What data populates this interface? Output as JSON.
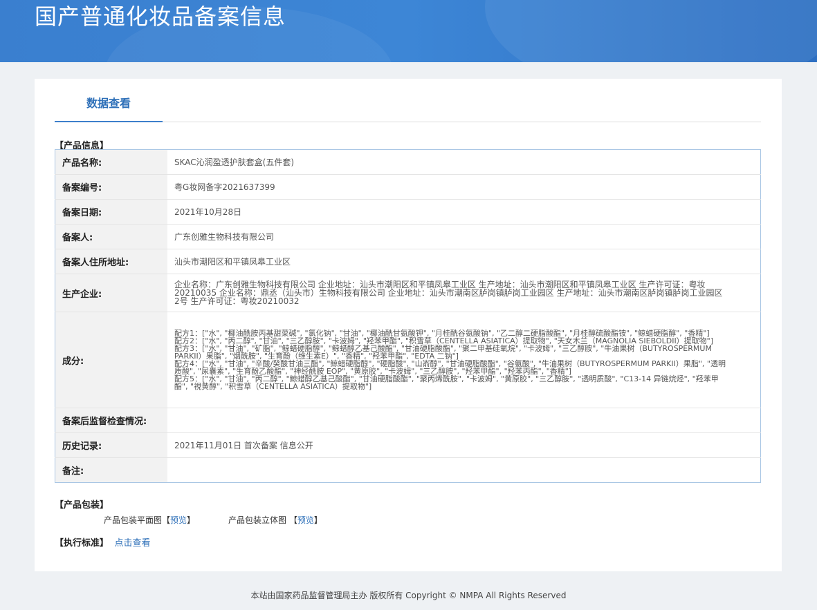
{
  "header": {
    "title": "国产普通化妆品备案信息"
  },
  "tabs": {
    "active": "数据查看"
  },
  "product_info": {
    "section_label": "【产品信息】",
    "rows": [
      {
        "label": "产品名称:",
        "value": "SKAC沁润盈透护肤套盒(五件套)"
      },
      {
        "label": "备案编号:",
        "value": "粤G妆网备字2021637399"
      },
      {
        "label": "备案日期:",
        "value": "2021年10月28日"
      },
      {
        "label": "备案人:",
        "value": "广东创雅生物科技有限公司"
      },
      {
        "label": "备案人住所地址:",
        "value": "汕头市潮阳区和平镇凤皋工业区"
      },
      {
        "label": "生产企业:",
        "value": "企业名称：广东创雅生物科技有限公司 企业地址：汕头市潮阳区和平镇凤皋工业区 生产地址：汕头市潮阳区和平镇凤皋工业区 生产许可证：粤妆20210035 企业名称：鼎丞（汕头市）生物科技有限公司 企业地址：汕头市潮南区胪岗镇胪岗工业园区 生产地址：汕头市潮南区胪岗镇胪岗工业园区2号 生产许可证：粤妆20210032"
      },
      {
        "label": "成分:",
        "value": "配方1：[\"水\", \"椰油酰胺丙基甜菜碱\", \"氯化钠\", \"甘油\", \"椰油酰甘氨酸钾\", \"月桂酰谷氨酸钠\", \"乙二醇二硬脂酸酯\", \"月桂醇硫酸酯铵\", \"鲸蜡硬脂醇\", \"香精\"]\n配方2：[\"水\", \"丙二醇\", \"甘油\", \"三乙醇胺\", \"卡波姆\", \"羟苯甲酯\", \"积雪草（CENTELLA ASIATICA）提取物\", \"天女木兰（MAGNOLIA SIEBOLDII）提取物\"]\n配方3：[\"水\", \"甘油\", \"矿脂\", \"鲸蜡硬脂醇\", \"鲸蜡醇乙基己酸酯\", \"甘油硬脂酸酯\", \"聚二甲基硅氧烷\", \"卡波姆\", \"三乙醇胺\", \"牛油果树（BUTYROSPERMUM PARKII）果脂\", \"烟酰胺\", \"生育酚（维生素E）\", \"香精\", \"羟苯甲酯\", \"EDTA 二钠\"]\n配方4：[\"水\", \"甘油\", \"辛酸/癸酸甘油三酯\", \"鲸蜡硬脂醇\", \"硬脂酸\", \"山嵛醇\", \"甘油硬脂酸酯\", \"谷氨酸\", \"牛油果树（BUTYROSPERMUM PARKII）果脂\", \"透明质酸\", \"尿囊素\", \"生育酚乙酸酯\", \"神经酰胺 EOP\", \"黄原胶\", \"卡波姆\", \"三乙醇胺\", \"羟苯甲酯\", \"羟苯丙酯\", \"香精\"]\n配方5：[\"水\", \"甘油\", \"丙二醇\", \"鲸蜡醇乙基己酸酯\", \"甘油硬脂酸酯\", \"聚丙烯酰胺\", \"卡波姆\", \"黄原胶\", \"三乙醇胺\", \"透明质酸\", \"C13-14 异链烷烃\", \"羟苯甲酯\", \"視黄醇\", \"积雪草（CENTELLA ASIATICA）提取物\"]"
      },
      {
        "label": "备案后监督检查情况:",
        "value": ""
      },
      {
        "label": "历史记录:",
        "value": "2021年11月01日 首次备案 信息公开"
      },
      {
        "label": "备注:",
        "value": ""
      }
    ]
  },
  "packaging": {
    "section_label": "【产品包装】",
    "flat_label": "产品包装平面图",
    "flat_link": "预览",
    "solid_label": "产品包装立体图",
    "solid_link": "预览",
    "bracket_open": "【",
    "bracket_close": "】"
  },
  "standard": {
    "section_label": "【执行标准】",
    "link": "点击查看"
  },
  "footer": {
    "text": "本站由国家药品监督管理局主办 版权所有 Copyright © NMPA All Rights Reserved"
  }
}
